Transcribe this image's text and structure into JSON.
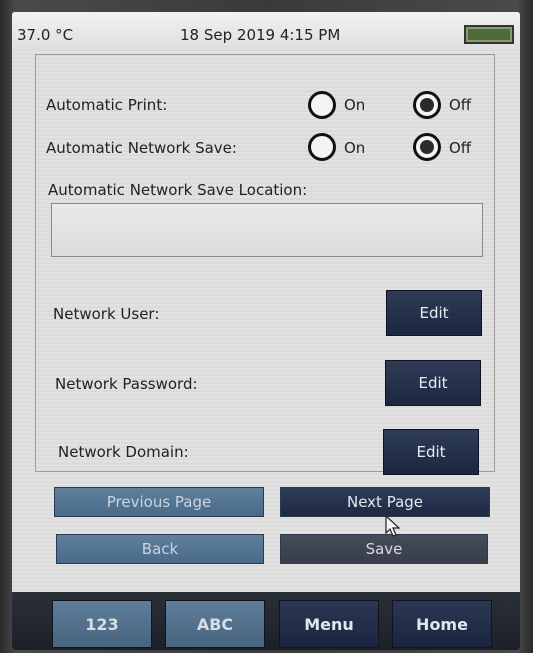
{
  "status": {
    "temperature": "37.0 °C",
    "datetime": "18 Sep 2019 4:15 PM",
    "battery_icon": "battery-icon"
  },
  "settings": {
    "automatic_print": {
      "label": "Automatic Print:",
      "on": "On",
      "off": "Off",
      "selected": "Off"
    },
    "automatic_network_save": {
      "label": "Automatic Network Save:",
      "on": "On",
      "off": "Off",
      "selected": "Off"
    },
    "save_location": {
      "label": "Automatic Network Save  Location:",
      "value": ""
    },
    "network_user": {
      "label": "Network User:",
      "button": "Edit"
    },
    "network_password": {
      "label": "Network Password:",
      "button": "Edit"
    },
    "network_domain": {
      "label": "Network Domain:",
      "button": "Edit"
    }
  },
  "nav": {
    "previous_page": "Previous Page",
    "next_page": "Next Page",
    "back": "Back",
    "save": "Save"
  },
  "bottom": {
    "num": "123",
    "abc": "ABC",
    "menu": "Menu",
    "home": "Home"
  },
  "colors": {
    "dark_button": "#1e2a44",
    "light_button": "#4a6a8a",
    "screen_bg": "#dedede"
  }
}
